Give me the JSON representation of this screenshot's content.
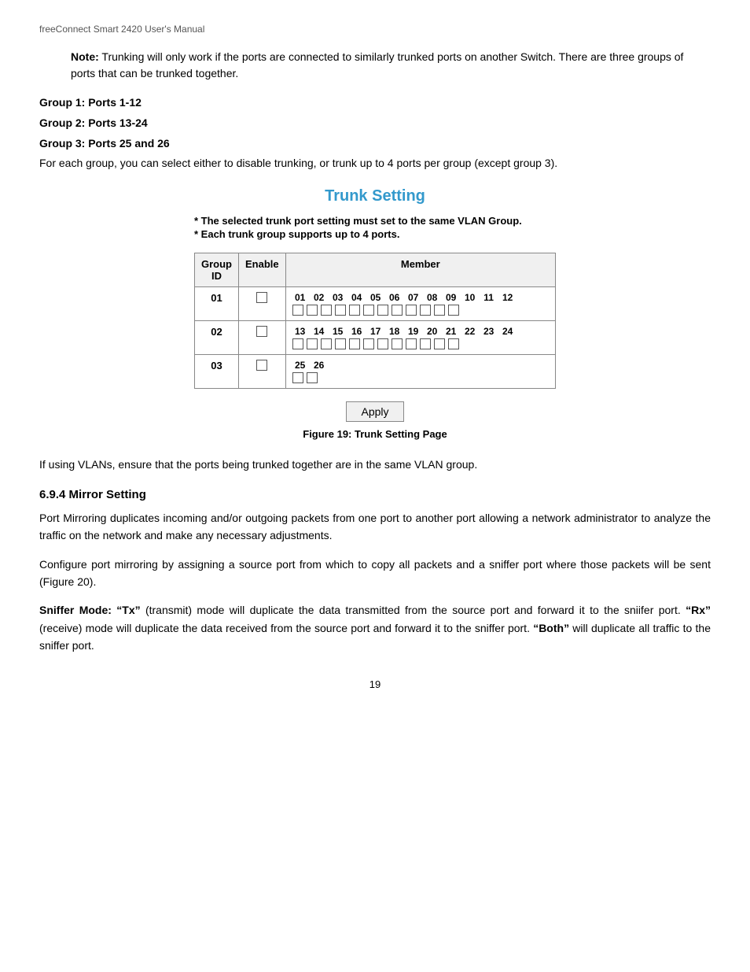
{
  "header": {
    "title": "freeConnect Smart 2420 User's Manual"
  },
  "note": {
    "label": "Note:",
    "text": "  Trunking will only work if the ports are connected to similarly trunked ports on another Switch.  There are three groups of ports that can be trunked together."
  },
  "groups": [
    {
      "label": "Group 1: Ports 1-12"
    },
    {
      "label": "Group 2: Ports 13-24"
    },
    {
      "label": "Group 3: Ports 25 and 26"
    }
  ],
  "body_text1": "For each group, you can select either to disable trunking, or trunk up to 4 ports per group (except group 3).",
  "trunk": {
    "title": "Trunk Setting",
    "note1": "* The selected trunk port setting must set to the same VLAN Group.",
    "note2": "* Each trunk group supports up to 4 ports.",
    "table": {
      "col_group": "Group\nID",
      "col_enable": "Enable",
      "col_member": "Member",
      "rows": [
        {
          "group_id": "01",
          "enable": false,
          "member_nums": [
            "01",
            "02",
            "03",
            "04",
            "05",
            "06",
            "07",
            "08",
            "09",
            "10",
            "11",
            "12"
          ],
          "member_checks": [
            false,
            false,
            false,
            false,
            false,
            false,
            false,
            false,
            false,
            false,
            false,
            false
          ]
        },
        {
          "group_id": "02",
          "enable": false,
          "member_nums": [
            "13",
            "14",
            "15",
            "16",
            "17",
            "18",
            "19",
            "20",
            "21",
            "22",
            "23",
            "24"
          ],
          "member_checks": [
            false,
            false,
            false,
            false,
            false,
            false,
            false,
            false,
            false,
            false,
            false,
            false
          ]
        },
        {
          "group_id": "03",
          "enable": false,
          "member_nums": [
            "25",
            "26"
          ],
          "member_checks": [
            false,
            false
          ]
        }
      ]
    },
    "apply_label": "Apply",
    "figure_caption": "Figure 19: Trunk Setting Page"
  },
  "vlan_note": "If using VLANs, ensure that the ports being trunked together are in the same VLAN group.",
  "section694": {
    "heading": "6.9.4  Mirror Setting",
    "para1": "Port Mirroring duplicates incoming and/or outgoing packets from one port to another port allowing a network administrator to analyze the traffic on the network and make any necessary adjustments.",
    "para2": "Configure port mirroring by assigning a source port from which to copy all packets and a sniffer port where those packets will be sent (Figure 20).",
    "para3_prefix": "Sniffer Mode: ",
    "para3_tx_label": "“Tx”",
    "para3_tx_text": " (transmit) mode will duplicate the data transmitted from the source port and forward it to the sniifer port.  ",
    "para3_rx_label": "“Rx”",
    "para3_rx_text": " (receive) mode will duplicate the data received from the source port and forward it to the sniffer port.  ",
    "para3_both_label": "“Both”",
    "para3_both_text": " will duplicate all traffic to the sniffer port."
  },
  "page_number": "19"
}
